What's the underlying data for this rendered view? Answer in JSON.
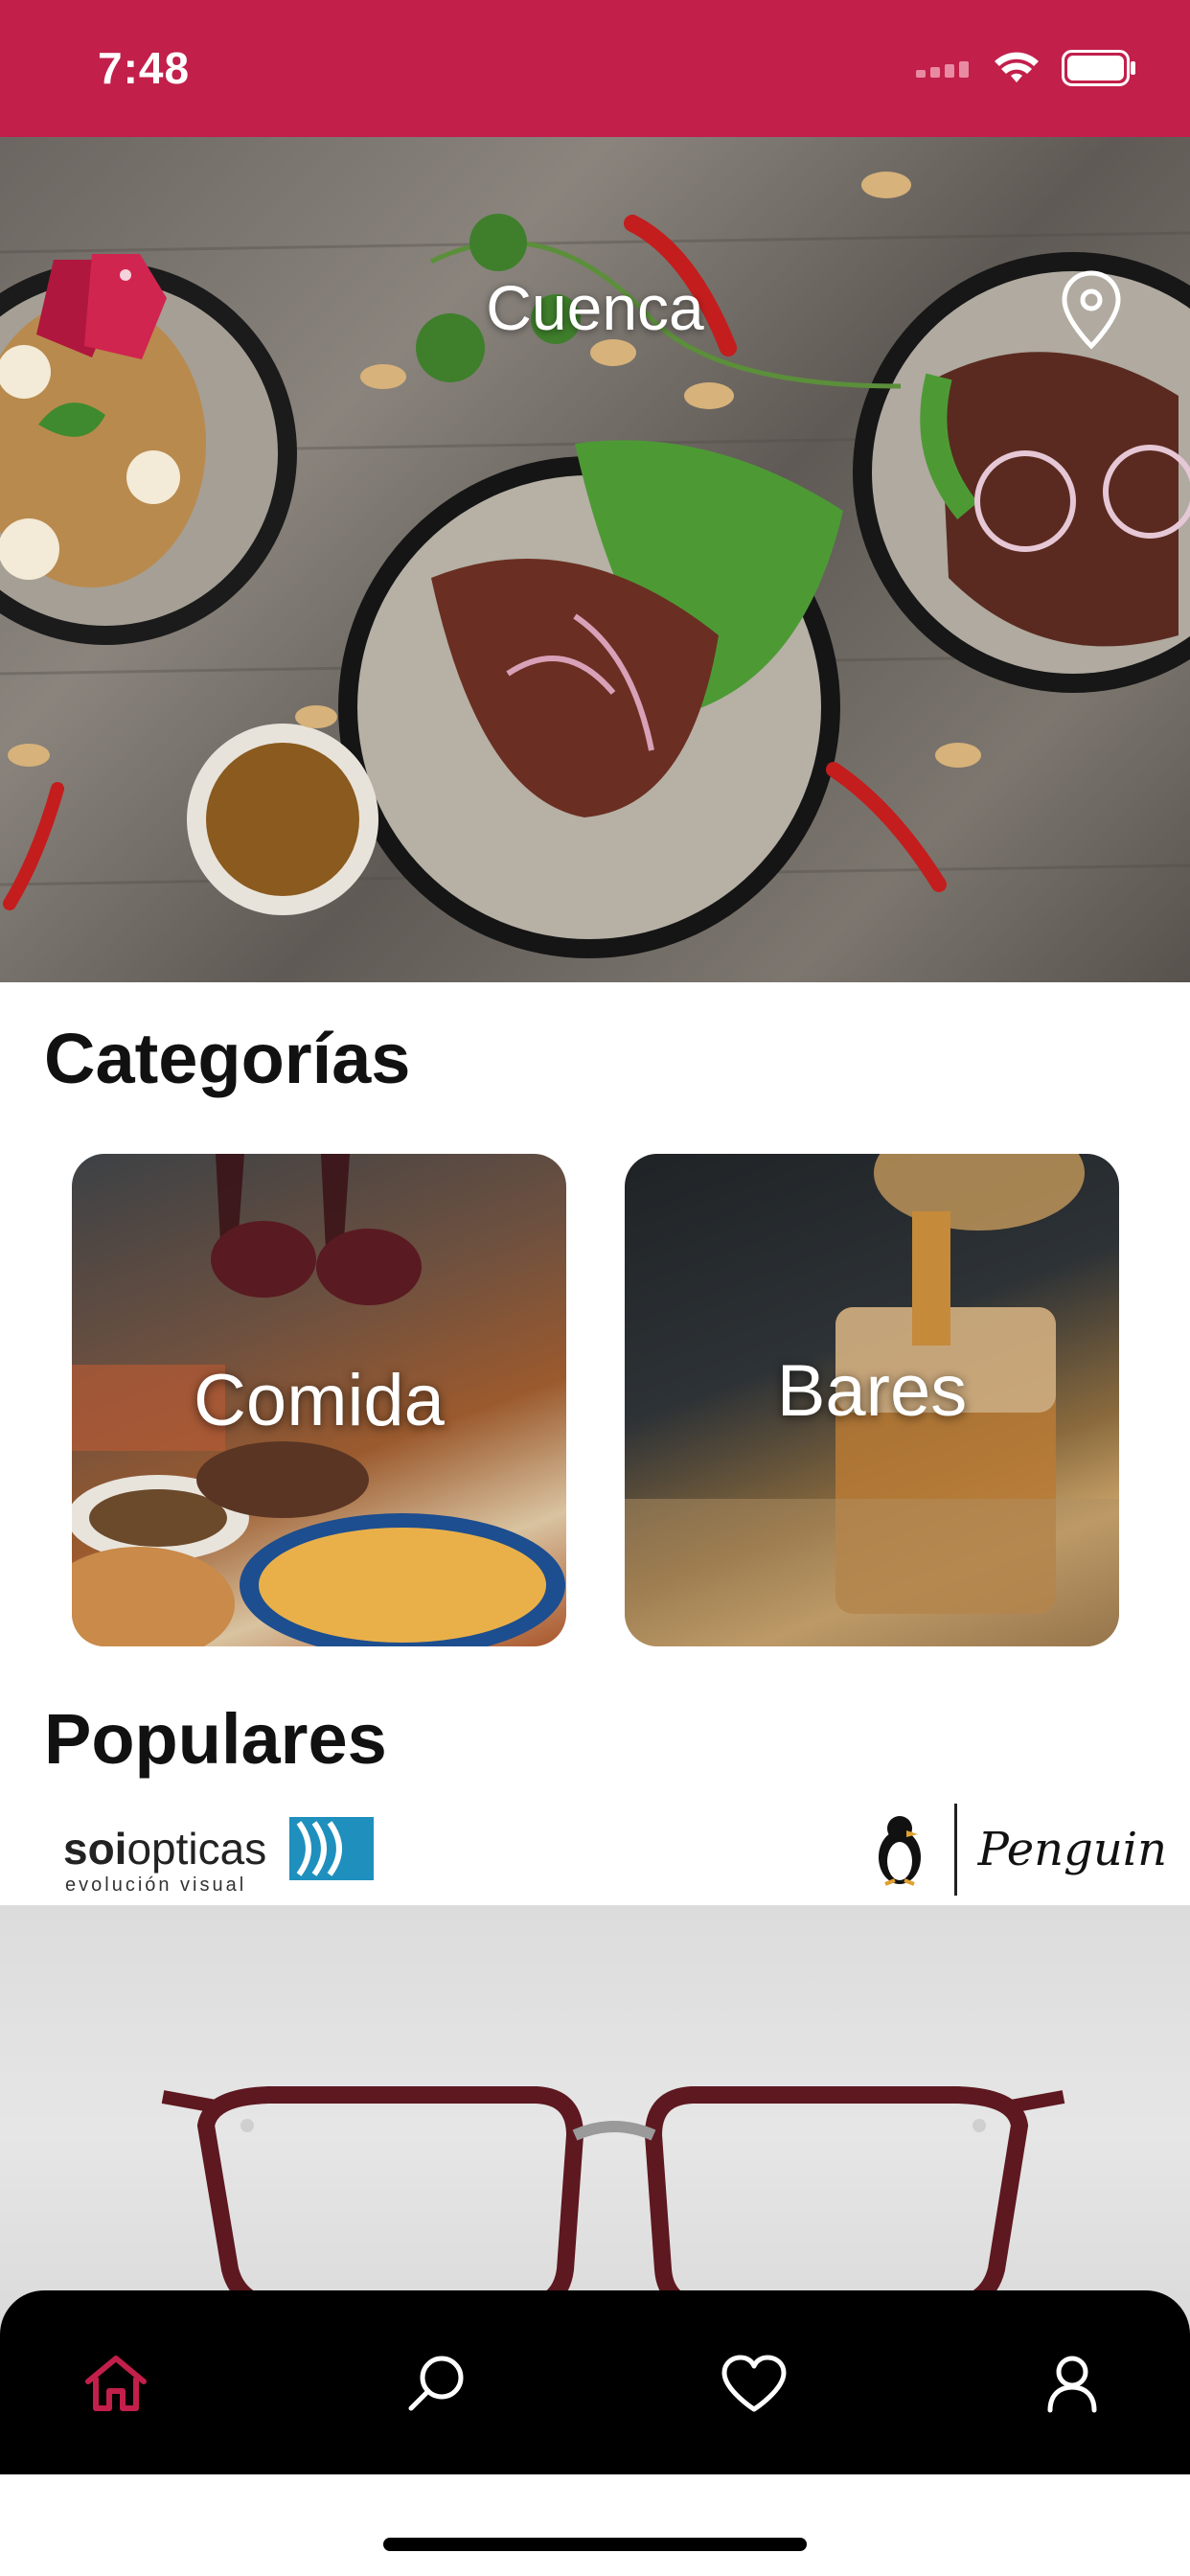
{
  "status_bar": {
    "time": "7:48"
  },
  "hero": {
    "city": "Cuenca"
  },
  "categories": {
    "title": "Categorías",
    "items": [
      {
        "label": "Comida"
      },
      {
        "label": "Bares"
      }
    ]
  },
  "popular": {
    "title": "Populares",
    "brands": [
      {
        "name_bold": "SOI",
        "name_rest": "opticas",
        "tagline": "evolución visual"
      },
      {
        "name": "Penguin"
      }
    ]
  },
  "tab_bar": {
    "items": [
      {
        "icon": "home-icon",
        "active": true
      },
      {
        "icon": "search-icon",
        "active": false
      },
      {
        "icon": "heart-icon",
        "active": false
      },
      {
        "icon": "user-icon",
        "active": false
      }
    ]
  },
  "colors": {
    "brand": "#c21f4b",
    "tab_bar_bg": "#000000",
    "tab_active": "#c21f4b",
    "tab_inactive": "#ffffff"
  }
}
